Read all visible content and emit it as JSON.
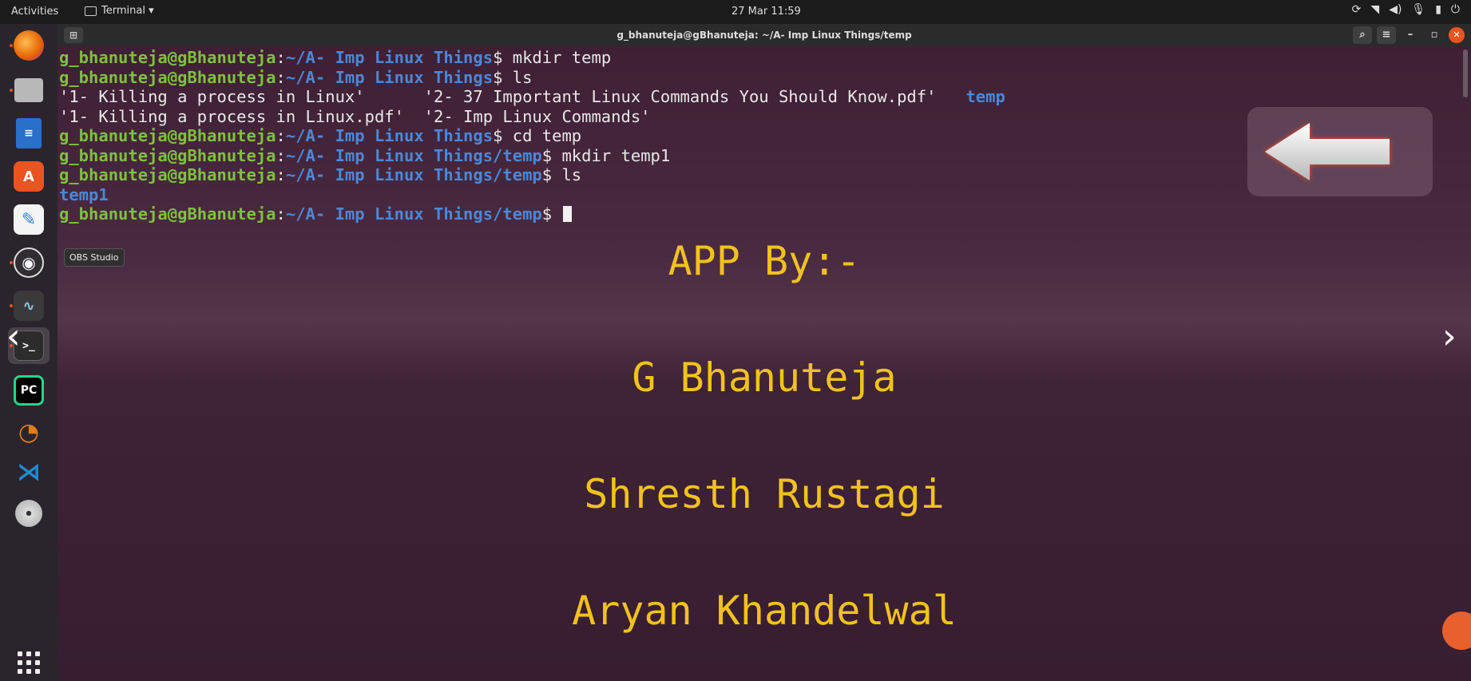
{
  "topbar": {
    "activities": "Activities",
    "app_menu": "Terminal ▾",
    "clock": "27 Mar  11:59",
    "tray_icons": [
      "update-icon",
      "wifi-icon",
      "volume-icon",
      "mic-icon",
      "battery-icon",
      "power-icon"
    ]
  },
  "dock": {
    "items": [
      {
        "name": "firefox",
        "icon": "firefox-icon",
        "running": true,
        "color": "#e66000"
      },
      {
        "name": "files",
        "icon": "folder-icon",
        "running": true,
        "color": "#a8a8a8"
      },
      {
        "name": "writer",
        "icon": "document-icon",
        "running": false,
        "color": "#2a6fc9"
      },
      {
        "name": "software",
        "icon": "software-store-icon",
        "running": false,
        "color": "#e95420"
      },
      {
        "name": "text-editor",
        "icon": "pencil-icon",
        "running": false,
        "color": "#3584e4"
      },
      {
        "name": "obs",
        "icon": "obs-icon",
        "running": true,
        "color": "#302e31"
      },
      {
        "name": "system-monitor",
        "icon": "monitor-icon",
        "running": true,
        "color": "#3a3a3a"
      },
      {
        "name": "terminal",
        "icon": "terminal-icon",
        "running": true,
        "color": "#2c2c2c",
        "active": true
      },
      {
        "name": "pycharm",
        "icon": "pycharm-icon",
        "running": false,
        "color": "#21d789"
      },
      {
        "name": "blender",
        "icon": "blender-icon",
        "running": false,
        "color": "#e87d0d"
      },
      {
        "name": "vscode",
        "icon": "vscode-icon",
        "running": false,
        "color": "#1f8ad2"
      },
      {
        "name": "dvd",
        "icon": "disc-icon",
        "running": false,
        "color": "#cccccc"
      }
    ],
    "tooltip": "OBS Studio"
  },
  "terminal": {
    "title": "g_bhanuteja@gBhanuteja: ~/A- Imp Linux Things/temp",
    "user": "g_bhanuteja@gBhanuteja",
    "lines": [
      {
        "type": "prompt",
        "path": "~/A- Imp Linux Things",
        "cmd": " mkdir temp"
      },
      {
        "type": "prompt",
        "path": "~/A- Imp Linux Things",
        "cmd": " ls"
      },
      {
        "type": "out",
        "text": "'1- Killing a process in Linux'      '2- 37 Important Linux Commands You Should Know.pdf'   ",
        "dir": "temp"
      },
      {
        "type": "out",
        "text": "'1- Killing a process in Linux.pdf'  '2- Imp Linux Commands'",
        "dir": ""
      },
      {
        "type": "prompt",
        "path": "~/A- Imp Linux Things",
        "cmd": " cd temp"
      },
      {
        "type": "prompt",
        "path": "~/A- Imp Linux Things/temp",
        "cmd": " mkdir temp1"
      },
      {
        "type": "prompt",
        "path": "~/A- Imp Linux Things/temp",
        "cmd": " ls"
      },
      {
        "type": "out",
        "text": "",
        "dir": "temp1"
      },
      {
        "type": "prompt",
        "path": "~/A- Imp Linux Things/temp",
        "cmd": " ",
        "cursor": true
      }
    ]
  },
  "overlay": {
    "credits_heading": "APP By:-",
    "authors": [
      "G Bhanuteja",
      "Shresth Rustagi",
      "Aryan Khandelwal"
    ]
  },
  "colors": {
    "prompt_user": "#7ec13d",
    "prompt_path": "#4a88d8",
    "credit_text": "#f1c21b"
  }
}
